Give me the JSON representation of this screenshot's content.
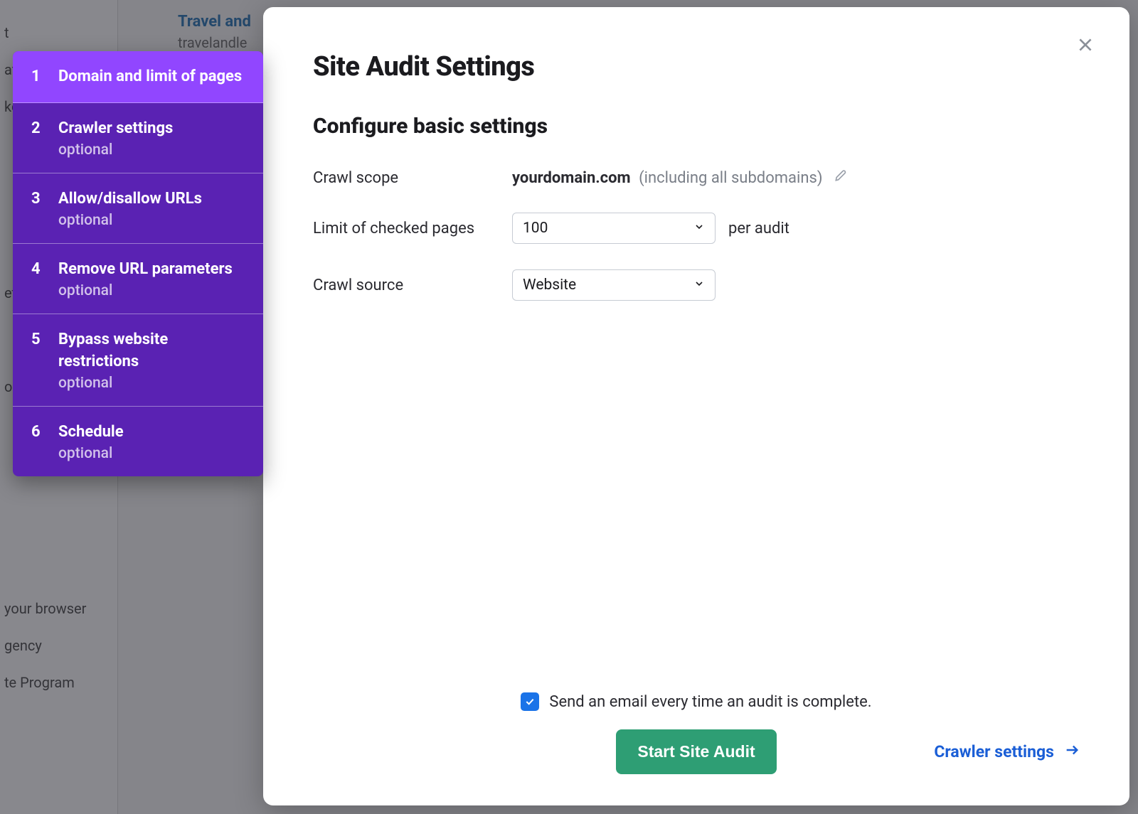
{
  "background": {
    "link_title": "Travel and",
    "link_sub": "travelandle",
    "sidebar_fragments": [
      "t",
      "ate",
      "ke",
      "",
      "et",
      "",
      "on",
      "",
      "",
      "your browser",
      "gency",
      "te Program"
    ]
  },
  "modal": {
    "title": "Site Audit Settings",
    "subtitle": "Configure basic settings",
    "close_icon": "close-icon",
    "fields": {
      "crawl_scope_label": "Crawl scope",
      "crawl_scope_value": "yourdomain.com",
      "crawl_scope_hint": "(including all subdomains)",
      "limit_label": "Limit of checked pages",
      "limit_value": "100",
      "limit_suffix": "per audit",
      "source_label": "Crawl source",
      "source_value": "Website"
    },
    "footer": {
      "email_checkbox_checked": true,
      "email_label": "Send an email every time an audit is complete.",
      "primary_button": "Start Site Audit",
      "next_link": "Crawler settings"
    }
  },
  "wizard": {
    "items": [
      {
        "num": "1",
        "title": "Domain and limit of pages",
        "sub": "",
        "active": true
      },
      {
        "num": "2",
        "title": "Crawler settings",
        "sub": "optional",
        "active": false
      },
      {
        "num": "3",
        "title": "Allow/disallow URLs",
        "sub": "optional",
        "active": false
      },
      {
        "num": "4",
        "title": "Remove URL parameters",
        "sub": "optional",
        "active": false
      },
      {
        "num": "5",
        "title": "Bypass website restrictions",
        "sub": "optional",
        "active": false
      },
      {
        "num": "6",
        "title": "Schedule",
        "sub": "optional",
        "active": false
      }
    ]
  }
}
